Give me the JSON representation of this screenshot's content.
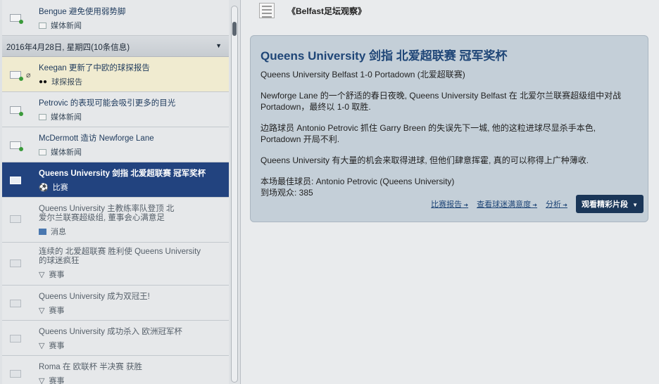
{
  "list": {
    "top": {
      "title": "Bengue 避免使用弱势脚",
      "cat": "媒体新闻"
    },
    "group_header": "2016年4月28日, 星期四(10条信息)",
    "items": [
      {
        "title": "Keegan 更新了中欧的球探报告",
        "cat": "球探报告"
      },
      {
        "title": "Petrovic 的表现可能会吸引更多的目光",
        "cat": "媒体新闻"
      },
      {
        "title": "McDermott 造访 Newforge Lane",
        "cat": "媒体新闻"
      },
      {
        "title": "Queens University 剑指 北爱超联赛 冠军奖杯",
        "cat": "比赛"
      },
      {
        "title": "Queens University 主教练率队登顶 北爱尔兰联赛超级组, 董事会心满意足",
        "cat": "消息"
      },
      {
        "title": "连续的 北爱超联赛 胜利使 Queens University 的球迷疯狂",
        "cat": "赛事"
      },
      {
        "title": "Queens University 成为双冠王!",
        "cat": "赛事"
      },
      {
        "title": "Queens University 成功杀入 欧洲冠军杯",
        "cat": "赛事"
      },
      {
        "title": "Roma 在 欧联杯 半决赛 获胜",
        "cat": "赛事"
      }
    ]
  },
  "detail": {
    "source": "《Belfast足坛观察》",
    "headline": "Queens University 剑指 北爱超联赛 冠军奖杯",
    "paragraphs": [
      "Queens University Belfast 1-0 Portadown (北爱超联赛)",
      "Newforge Lane 的一个舒适的春日夜晚, Queens University Belfast 在 北爱尔兰联赛超级组中对战 Portadown，最终以 1-0 取胜.",
      "边路球员 Antonio Petrovic 抓住 Garry Breen 的失误先下一城, 他的这粒进球尽显杀手本色, Portadown 开局不利.",
      "Queens University 有大量的机会来取得进球, 但他们肆意挥霍, 真的可以称得上广种薄收."
    ],
    "best_player": "本场最佳球员: Antonio Petrovic (Queens University)",
    "attendance": "到场观众: 385",
    "links": [
      "比赛报告",
      "查看球迷满意度",
      "分析"
    ],
    "highlights_button": "观看精彩片段"
  }
}
